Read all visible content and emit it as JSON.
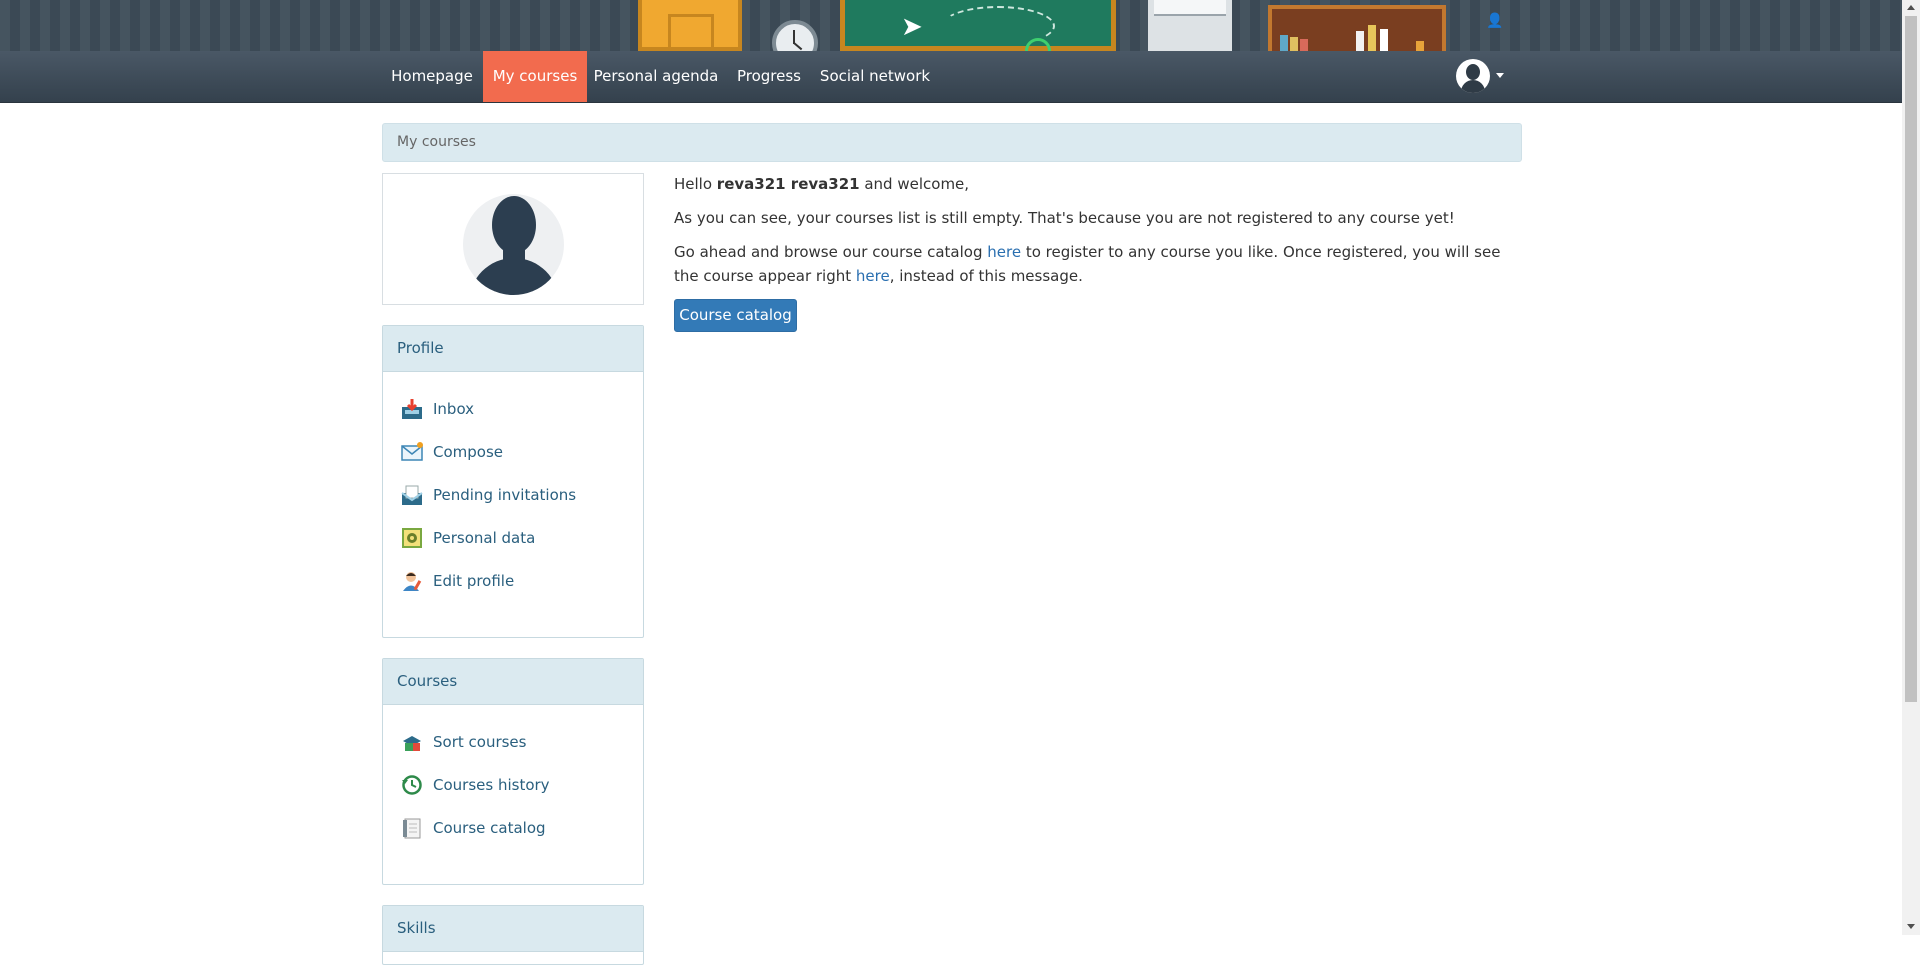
{
  "nav": {
    "items": [
      {
        "label": "Homepage",
        "active": false
      },
      {
        "label": "My courses",
        "active": true
      },
      {
        "label": "Personal agenda",
        "active": false
      },
      {
        "label": "Progress",
        "active": false
      },
      {
        "label": "Social network",
        "active": false
      }
    ],
    "accent_color": "#f26b4e"
  },
  "breadcrumb": "My courses",
  "profile_panel": {
    "title": "Profile",
    "items": [
      {
        "label": "Inbox",
        "icon": "inbox-icon"
      },
      {
        "label": "Compose",
        "icon": "compose-icon"
      },
      {
        "label": "Pending invitations",
        "icon": "pending-invitations-icon"
      },
      {
        "label": "Personal data",
        "icon": "personal-data-icon"
      },
      {
        "label": "Edit profile",
        "icon": "edit-profile-icon"
      }
    ]
  },
  "courses_panel": {
    "title": "Courses",
    "items": [
      {
        "label": "Sort courses",
        "icon": "sort-courses-icon"
      },
      {
        "label": "Courses history",
        "icon": "courses-history-icon"
      },
      {
        "label": "Course catalog",
        "icon": "course-catalog-icon"
      }
    ]
  },
  "skills_panel": {
    "title": "Skills"
  },
  "welcome": {
    "hello": "Hello ",
    "username": "reva321 reva321",
    "welcome_suffix": " and welcome,",
    "empty_message": "As you can see, your courses list is still empty. That's because you are not registered to any course yet!",
    "browse_prefix": "Go ahead and browse our course catalog ",
    "link_here": "here",
    "browse_middle": " to register to any course you like. Once registered, you will see the course appear right ",
    "browse_suffix": ", instead of this message.",
    "button": "Course catalog"
  }
}
